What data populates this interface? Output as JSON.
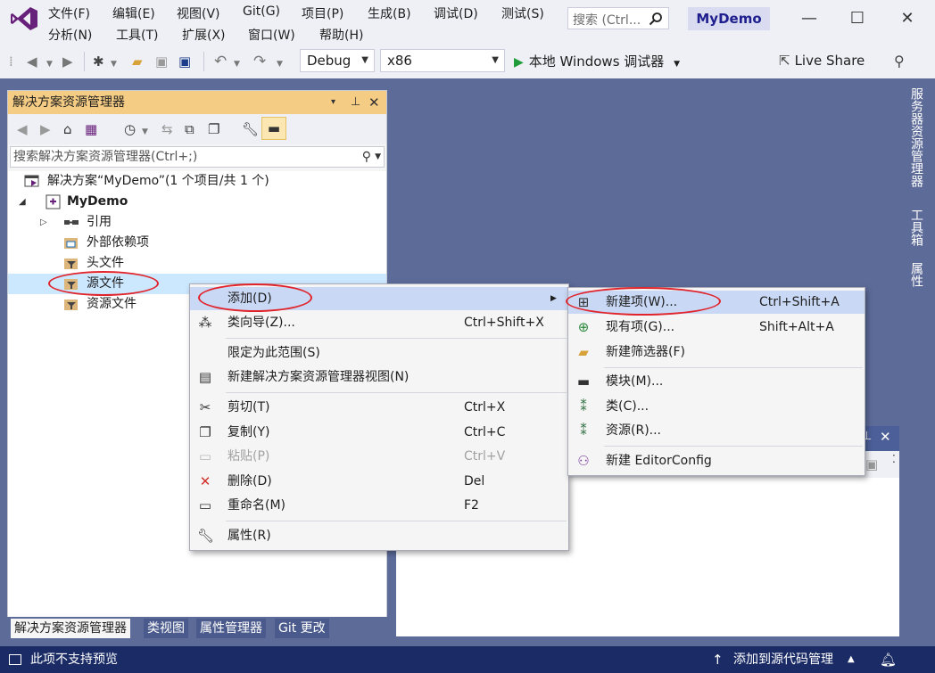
{
  "menubar": {
    "row1": [
      "文件(F)",
      "编辑(E)",
      "视图(V)",
      "Git(G)",
      "项目(P)",
      "生成(B)",
      "调试(D)",
      "测试(S)"
    ],
    "row2": [
      "分析(N)",
      "工具(T)",
      "扩展(X)",
      "窗口(W)",
      "帮助(H)"
    ],
    "search_placeholder": "搜索 (Ctrl...",
    "project_name": "MyDemo",
    "window_controls": [
      "—",
      "☐",
      "✕"
    ]
  },
  "toolbar": {
    "config": "Debug",
    "platform": "x86",
    "run_label": "本地 Windows 调试器",
    "live_share": "Live Share"
  },
  "explorer": {
    "title": "解决方案资源管理器",
    "header_buttons": [
      "▾",
      "📌",
      "✕"
    ],
    "search_placeholder": "搜索解决方案资源管理器(Ctrl+;)",
    "tree": [
      {
        "label": "解决方案“MyDemo”(1 个项目/共 1 个)",
        "icon": "solution-icon",
        "level": 0
      },
      {
        "label": "MyDemo",
        "icon": "project-icon",
        "level": 1,
        "bold": true,
        "expanded": true
      },
      {
        "label": "引用",
        "icon": "references-icon",
        "level": 2,
        "collapsed": true
      },
      {
        "label": "外部依赖项",
        "icon": "external-deps-icon",
        "level": 2
      },
      {
        "label": "头文件",
        "icon": "filter-folder-icon",
        "level": 2
      },
      {
        "label": "源文件",
        "icon": "filter-folder-icon",
        "level": 2,
        "selected": true
      },
      {
        "label": "资源文件",
        "icon": "filter-folder-icon",
        "level": 2
      }
    ],
    "bottom_tabs": [
      "解决方案资源管理器",
      "类视图",
      "属性管理器",
      "Git 更改"
    ]
  },
  "side_tabs": [
    "服务器资源管理器",
    "工具箱",
    "属性"
  ],
  "context_menu": {
    "items": [
      {
        "label": "添加(D)",
        "submenu": true,
        "highlighted": true
      },
      {
        "label": "类向导(Z)...",
        "shortcut": "Ctrl+Shift+X",
        "icon": "class-wizard-icon"
      },
      {
        "separator": true
      },
      {
        "label": "限定为此范围(S)"
      },
      {
        "label": "新建解决方案资源管理器视图(N)",
        "icon": "new-view-icon"
      },
      {
        "separator": true
      },
      {
        "label": "剪切(T)",
        "shortcut": "Ctrl+X",
        "icon": "cut-icon"
      },
      {
        "label": "复制(Y)",
        "shortcut": "Ctrl+C",
        "icon": "copy-icon"
      },
      {
        "label": "粘贴(P)",
        "shortcut": "Ctrl+V",
        "icon": "paste-icon",
        "disabled": true
      },
      {
        "label": "删除(D)",
        "shortcut": "Del",
        "icon": "delete-icon"
      },
      {
        "label": "重命名(M)",
        "shortcut": "F2",
        "icon": "rename-icon"
      },
      {
        "separator": true
      },
      {
        "label": "属性(R)",
        "icon": "wrench-icon"
      }
    ]
  },
  "submenu": {
    "items": [
      {
        "label": "新建项(W)...",
        "shortcut": "Ctrl+Shift+A",
        "icon": "new-item-icon",
        "highlighted": true
      },
      {
        "label": "现有项(G)...",
        "shortcut": "Shift+Alt+A",
        "icon": "existing-item-icon"
      },
      {
        "label": "新建筛选器(F)",
        "icon": "new-filter-icon"
      },
      {
        "separator": true
      },
      {
        "label": "模块(M)...",
        "icon": "module-icon"
      },
      {
        "label": "类(C)...",
        "icon": "class-icon"
      },
      {
        "label": "资源(R)...",
        "icon": "resource-icon"
      },
      {
        "separator": true
      },
      {
        "label": "新建 EditorConfig",
        "icon": "editorconfig-icon"
      }
    ]
  },
  "statusbar": {
    "left": "此项不支持预览",
    "right": "添加到源代码管理"
  },
  "colors": {
    "accent": "#68217a",
    "header": "#f5cc84",
    "statusbar": "#1a2b66",
    "highlight": "#c9d8f5",
    "annotation": "#e1242b"
  }
}
